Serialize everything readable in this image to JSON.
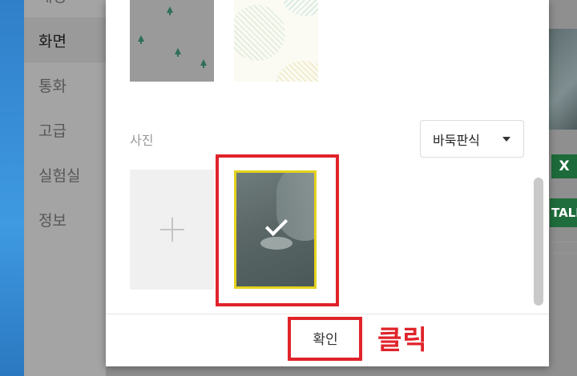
{
  "sidebar": {
    "items": [
      {
        "label": "배경",
        "active": false
      },
      {
        "label": "화면",
        "active": true
      },
      {
        "label": "통화",
        "active": false
      },
      {
        "label": "고급",
        "active": false
      },
      {
        "label": "실험실",
        "active": false
      },
      {
        "label": "정보",
        "active": false
      }
    ]
  },
  "dialog": {
    "photo_section_label": "사진",
    "sort_select": {
      "value": "바둑판식",
      "icon": "caret-down-icon"
    },
    "add_photo_icon": "plus-icon",
    "selected_photo": {
      "selected": true,
      "icon": "checkmark-icon",
      "border_color": "#e5d21f"
    },
    "confirm_label": "확인"
  },
  "background_app": {
    "excel_label": "X",
    "talk_label": "TALI"
  },
  "annotation": {
    "click_label": "클릭",
    "color": "#e0232a"
  }
}
